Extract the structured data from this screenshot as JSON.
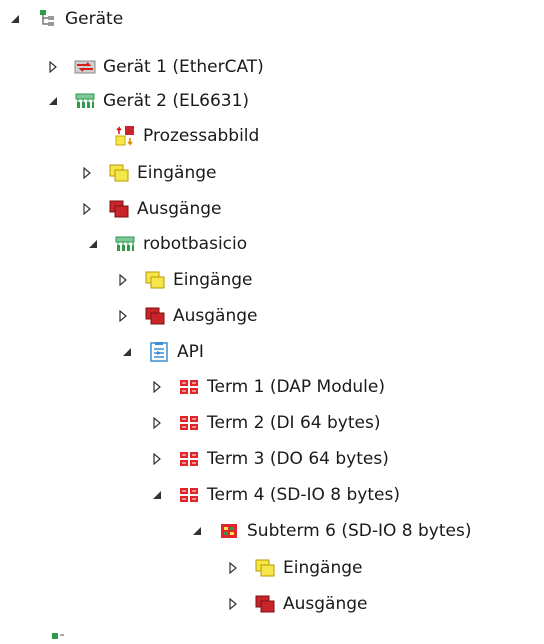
{
  "tree": {
    "root": {
      "label": "Geräte",
      "icon": "devices-tree-icon"
    },
    "geraet1": {
      "label": "Gerät 1 (EtherCAT)",
      "icon": "ethercat-device-icon"
    },
    "geraet2": {
      "label": "Gerät 2 (EL6631)",
      "icon": "profinet-device-icon"
    },
    "prozessabbild": {
      "label": "Prozessabbild",
      "icon": "process-image-icon"
    },
    "eingaenge1": {
      "label": "Eingänge",
      "icon": "inputs-icon"
    },
    "ausgaenge1": {
      "label": "Ausgänge",
      "icon": "outputs-icon"
    },
    "robotbasicio": {
      "label": "robotbasicio",
      "icon": "profinet-device-icon"
    },
    "eingaenge2": {
      "label": "Eingänge",
      "icon": "inputs-icon"
    },
    "ausgaenge2": {
      "label": "Ausgänge",
      "icon": "outputs-icon"
    },
    "api": {
      "label": "API",
      "icon": "api-icon"
    },
    "term1": {
      "label": "Term 1 (DAP Module)",
      "icon": "terminal-module-icon"
    },
    "term2": {
      "label": "Term 2 (DI 64 bytes)",
      "icon": "terminal-module-icon"
    },
    "term3": {
      "label": "Term 3 (DO 64 bytes)",
      "icon": "terminal-module-icon"
    },
    "term4": {
      "label": "Term 4 (SD-IO 8 bytes)",
      "icon": "terminal-module-icon"
    },
    "subterm6": {
      "label": "Subterm 6 (SD-IO 8 bytes)",
      "icon": "subterm-module-icon"
    },
    "eingaenge3": {
      "label": "Eingänge",
      "icon": "inputs-icon"
    },
    "ausgaenge3": {
      "label": "Ausgänge",
      "icon": "outputs-icon"
    }
  },
  "colors": {
    "inputs_fill": "#f5e64a",
    "outputs_fill": "#c8252a",
    "terminal_red": "#e0262b",
    "api_blue": "#3d8ed6",
    "profinet_green": "#2e9a4a"
  }
}
